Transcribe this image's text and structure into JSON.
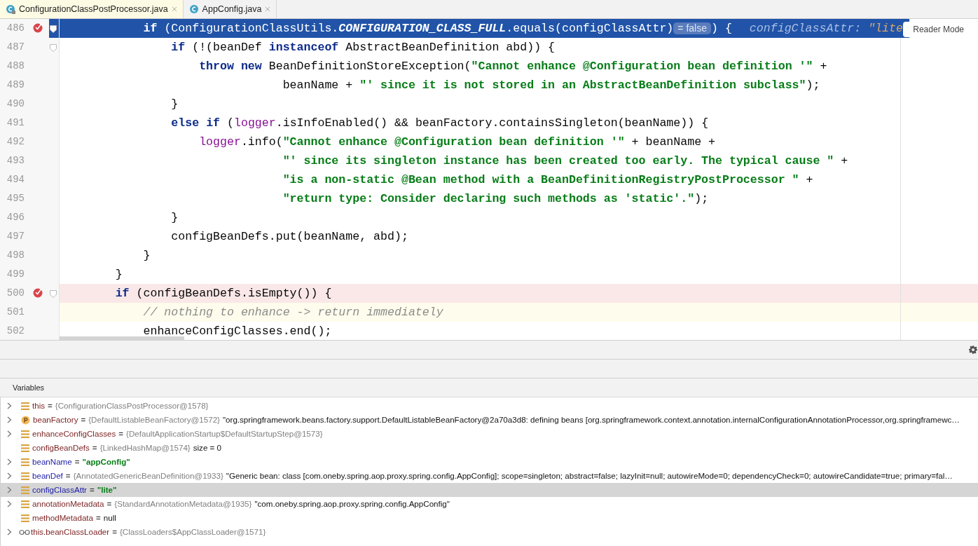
{
  "tabs": [
    {
      "label": "ConfigurationClassPostProcessor.java",
      "selected": true,
      "locked": true
    },
    {
      "label": "AppConfig.java",
      "selected": false,
      "locked": false
    }
  ],
  "editor": {
    "reader_mode": "Reader Mode",
    "lines": [
      {
        "number": "486",
        "kind": "execution",
        "breakpoint": true,
        "fold": true,
        "tokens": [
          {
            "kind": "keyword",
            "text": "            if"
          },
          {
            "kind": "plain",
            "text": " (ConfigurationClassUtils."
          },
          {
            "kind": "static",
            "text": "CONFIGURATION_CLASS_FULL"
          },
          {
            "kind": "plain",
            "text": ".equals(configClassAttr)"
          },
          {
            "kind": "hint",
            "text": "= false"
          },
          {
            "kind": "plain",
            "text": ") {"
          },
          {
            "kind": "inline-value",
            "text": "configClassAttr: "
          },
          {
            "kind": "inline-string",
            "text": "\"lite"
          }
        ]
      },
      {
        "number": "487",
        "kind": "normal",
        "breakpoint": false,
        "fold": true,
        "tokens": [
          {
            "kind": "keyword",
            "text": "                if"
          },
          {
            "kind": "plain",
            "text": " (!(beanDef "
          },
          {
            "kind": "keyword",
            "text": "instanceof"
          },
          {
            "kind": "plain",
            "text": " AbstractBeanDefinition abd)) {"
          }
        ]
      },
      {
        "number": "488",
        "kind": "normal",
        "breakpoint": false,
        "fold": false,
        "tokens": [
          {
            "kind": "keyword",
            "text": "                    throw"
          },
          {
            "kind": "keyword",
            "text": " new"
          },
          {
            "kind": "plain",
            "text": " BeanDefinitionStoreException("
          },
          {
            "kind": "string",
            "text": "\"Cannot enhance @Configuration bean definition '\""
          },
          {
            "kind": "plain",
            "text": " +"
          }
        ]
      },
      {
        "number": "489",
        "kind": "normal",
        "breakpoint": false,
        "fold": false,
        "tokens": [
          {
            "kind": "plain",
            "text": "                                beanName + "
          },
          {
            "kind": "string",
            "text": "\"' since it is not stored in an AbstractBeanDefinition subclass\""
          },
          {
            "kind": "plain",
            "text": ");"
          }
        ]
      },
      {
        "number": "490",
        "kind": "normal",
        "breakpoint": false,
        "fold": false,
        "tokens": [
          {
            "kind": "plain",
            "text": "                }"
          }
        ]
      },
      {
        "number": "491",
        "kind": "normal",
        "breakpoint": false,
        "fold": false,
        "tokens": [
          {
            "kind": "keyword",
            "text": "                else"
          },
          {
            "kind": "keyword",
            "text": " if"
          },
          {
            "kind": "plain",
            "text": " ("
          },
          {
            "kind": "field",
            "text": "logger"
          },
          {
            "kind": "plain",
            "text": ".isInfoEnabled() && beanFactory.containsSingleton(beanName)) {"
          }
        ]
      },
      {
        "number": "492",
        "kind": "normal",
        "breakpoint": false,
        "fold": false,
        "tokens": [
          {
            "kind": "field",
            "text": "                    logger"
          },
          {
            "kind": "plain",
            "text": ".info("
          },
          {
            "kind": "string",
            "text": "\"Cannot enhance @Configuration bean definition '\""
          },
          {
            "kind": "plain",
            "text": " + beanName +"
          }
        ]
      },
      {
        "number": "493",
        "kind": "normal",
        "breakpoint": false,
        "fold": false,
        "tokens": [
          {
            "kind": "string",
            "text": "                                \"' since its singleton instance has been created too early. The typical cause \""
          },
          {
            "kind": "plain",
            "text": " +"
          }
        ]
      },
      {
        "number": "494",
        "kind": "normal",
        "breakpoint": false,
        "fold": false,
        "tokens": [
          {
            "kind": "string",
            "text": "                                \"is a non-static @Bean method with a BeanDefinitionRegistryPostProcessor \""
          },
          {
            "kind": "plain",
            "text": " +"
          }
        ]
      },
      {
        "number": "495",
        "kind": "normal",
        "breakpoint": false,
        "fold": false,
        "tokens": [
          {
            "kind": "string",
            "text": "                                \"return type: Consider declaring such methods as 'static'.\""
          },
          {
            "kind": "plain",
            "text": ");"
          }
        ]
      },
      {
        "number": "496",
        "kind": "normal",
        "breakpoint": false,
        "fold": false,
        "tokens": [
          {
            "kind": "plain",
            "text": "                }"
          }
        ]
      },
      {
        "number": "497",
        "kind": "normal",
        "breakpoint": false,
        "fold": false,
        "tokens": [
          {
            "kind": "plain",
            "text": "                configBeanDefs.put(beanName, abd);"
          }
        ]
      },
      {
        "number": "498",
        "kind": "normal",
        "breakpoint": false,
        "fold": false,
        "tokens": [
          {
            "kind": "plain",
            "text": "            }"
          }
        ]
      },
      {
        "number": "499",
        "kind": "normal",
        "breakpoint": false,
        "fold": false,
        "tokens": [
          {
            "kind": "plain",
            "text": "        }"
          }
        ]
      },
      {
        "number": "500",
        "kind": "breakpoint-line",
        "breakpoint": true,
        "fold": true,
        "tokens": [
          {
            "kind": "keyword",
            "text": "        if"
          },
          {
            "kind": "plain",
            "text": " (configBeanDefs.isEmpty()) {"
          }
        ]
      },
      {
        "number": "501",
        "kind": "caret",
        "breakpoint": false,
        "fold": false,
        "tokens": [
          {
            "kind": "comment",
            "text": "            // nothing to enhance -> return immediately"
          }
        ]
      },
      {
        "number": "502",
        "kind": "normal",
        "breakpoint": false,
        "fold": false,
        "tokens": [
          {
            "kind": "plain",
            "text": "            enhanceConfigClasses.end();"
          }
        ]
      }
    ]
  },
  "variables": {
    "title": "Variables",
    "rows": [
      {
        "expandable": true,
        "kind": "field",
        "name": "this",
        "color": "#7a1f1f",
        "selected": false,
        "equals": "=",
        "type": "{ConfigurationClassPostProcessor@1578}"
      },
      {
        "expandable": true,
        "kind": "parameter",
        "name": "beanFactory",
        "color": "#7a1f1f",
        "selected": false,
        "equals": "=",
        "type": "{DefaultListableBeanFactory@1572}",
        "value": "\"org.springframework.beans.factory.support.DefaultListableBeanFactory@2a70a3d8: defining beans [org.springframework.context.annotation.internalConfigurationAnnotationProcessor,org.springframewc…"
      },
      {
        "expandable": true,
        "kind": "field",
        "name": "enhanceConfigClasses",
        "color": "#7a1f1f",
        "selected": false,
        "equals": "=",
        "type": "{DefaultApplicationStartup$DefaultStartupStep@1573}"
      },
      {
        "expandable": false,
        "kind": "field",
        "name": "configBeanDefs",
        "color": "#7a1f1f",
        "selected": false,
        "equals": "=",
        "type": "{LinkedHashMap@1574}",
        "value": "size = 0"
      },
      {
        "expandable": true,
        "kind": "field",
        "name": "beanName",
        "color": "#1a1aa6",
        "selected": false,
        "equals": "=",
        "string_value": "\"appConfig\""
      },
      {
        "expandable": true,
        "kind": "field",
        "name": "beanDef",
        "color": "#1a1aa6",
        "selected": false,
        "equals": "=",
        "type": "{AnnotatedGenericBeanDefinition@1933}",
        "value": "\"Generic bean: class [com.oneby.spring.aop.proxy.spring.config.AppConfig]; scope=singleton; abstract=false; lazyInit=null; autowireMode=0; dependencyCheck=0; autowireCandidate=true; primary=fal…"
      },
      {
        "expandable": true,
        "kind": "field",
        "name": "configClassAttr",
        "color": "#1a1aa6",
        "selected": true,
        "equals": "=",
        "string_value": "\"lite\""
      },
      {
        "expandable": true,
        "kind": "field",
        "name": "annotationMetadata",
        "color": "#7a1f1f",
        "selected": false,
        "equals": "=",
        "type": "{StandardAnnotationMetadata@1935}",
        "value": "\"com.oneby.spring.aop.proxy.spring.config.AppConfig\""
      },
      {
        "expandable": false,
        "kind": "field",
        "name": "methodMetadata",
        "color": "#7a1f1f",
        "selected": false,
        "equals": "=",
        "value": "null"
      },
      {
        "expandable": true,
        "kind": "watch",
        "name": "this.beanClassLoader",
        "color": "#7a1f1f",
        "selected": false,
        "equals": "=",
        "type": "{ClassLoaders$AppClassLoader@1571}"
      }
    ]
  }
}
